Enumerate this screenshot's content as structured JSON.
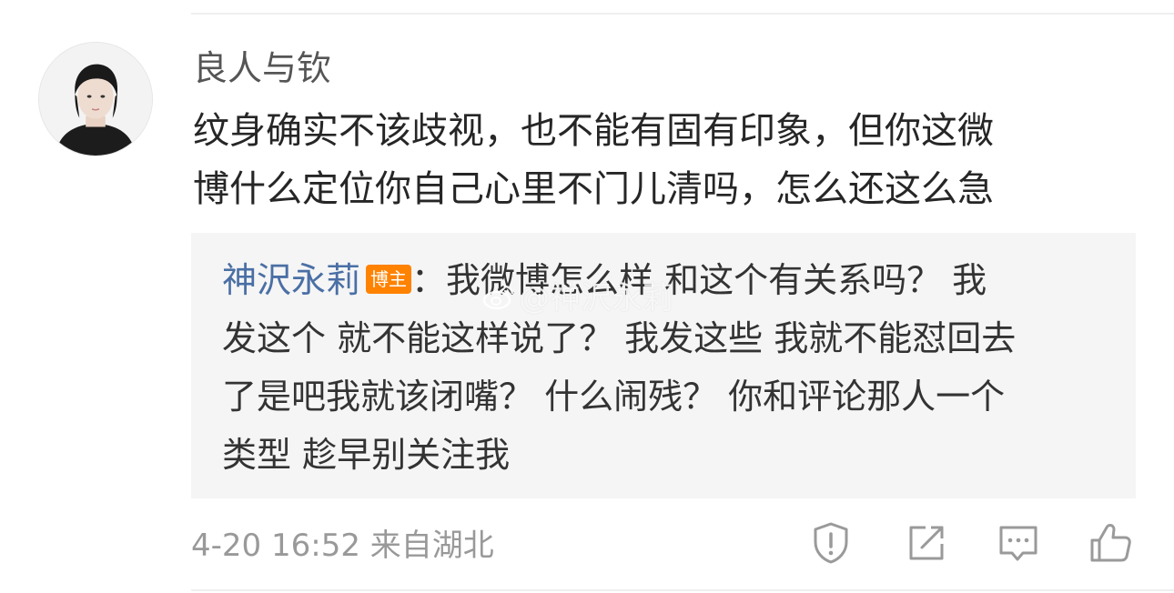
{
  "comment": {
    "username": "良人与钦",
    "text_lines": [
      "纹身确实不该歧视，也不能有固有印象，但你这微",
      "博什么定位你自己心里不门儿清吗，怎么还这么急"
    ]
  },
  "reply": {
    "author": "神沢永莉",
    "badge": "博主",
    "line1_rest": "：我微博怎么样 和这个有关系吗？ 我",
    "line2": "发这个 就不能这样说了？ 我发这些 我就不能怼回去",
    "line3": "了是吧我就该闭嘴？ 什么闹残？  你和评论那人一个",
    "line4": "类型 趁早别关注我"
  },
  "watermark": {
    "text": "@神沢永莉"
  },
  "meta": {
    "time": "4-20 16:52",
    "location": "来自湖北"
  },
  "icons": [
    "avatar",
    "report-icon",
    "share-icon",
    "reply-comment-icon",
    "like-icon"
  ],
  "colors": {
    "author_link": "#4a6fa5",
    "badge": "#ff8200",
    "reply_bg": "#f5f5f5",
    "meta": "#999999"
  }
}
